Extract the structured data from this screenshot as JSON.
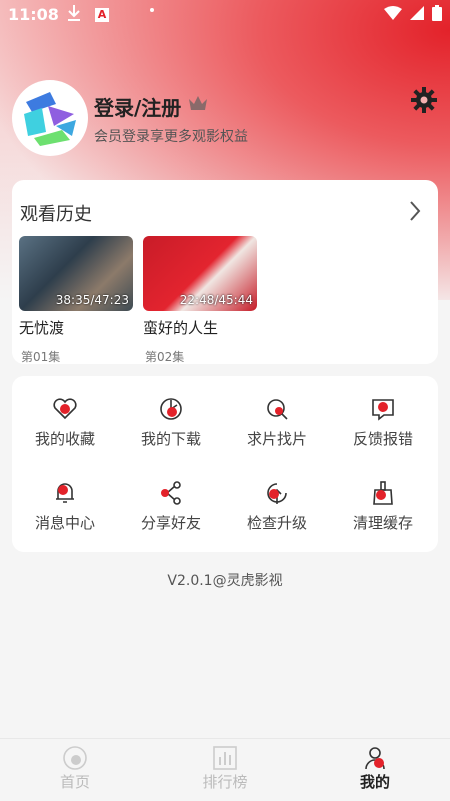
{
  "status_bar": {
    "time": "11:08"
  },
  "profile": {
    "title": "登录/注册",
    "subtitle": "会员登录享更多观影权益"
  },
  "history": {
    "title": "观看历史",
    "items": [
      {
        "name": "无忧渡",
        "progress": "38:35/47:23",
        "episode": "第01集"
      },
      {
        "name": "蛮好的人生",
        "progress": "22:48/45:44",
        "episode": "第02集"
      }
    ]
  },
  "tools": [
    {
      "label": "我的收藏",
      "icon": "heart-icon"
    },
    {
      "label": "我的下载",
      "icon": "download-icon"
    },
    {
      "label": "求片找片",
      "icon": "search-film-icon"
    },
    {
      "label": "反馈报错",
      "icon": "feedback-icon"
    },
    {
      "label": "消息中心",
      "icon": "bell-icon"
    },
    {
      "label": "分享好友",
      "icon": "share-icon"
    },
    {
      "label": "检查升级",
      "icon": "upgrade-icon"
    },
    {
      "label": "清理缓存",
      "icon": "broom-icon"
    }
  ],
  "version": "V2.0.1@灵虎影视",
  "tabs": [
    {
      "label": "首页"
    },
    {
      "label": "排行榜"
    },
    {
      "label": "我的"
    }
  ],
  "colors": {
    "accent": "#e3222a",
    "background": "#f5f5f5"
  }
}
